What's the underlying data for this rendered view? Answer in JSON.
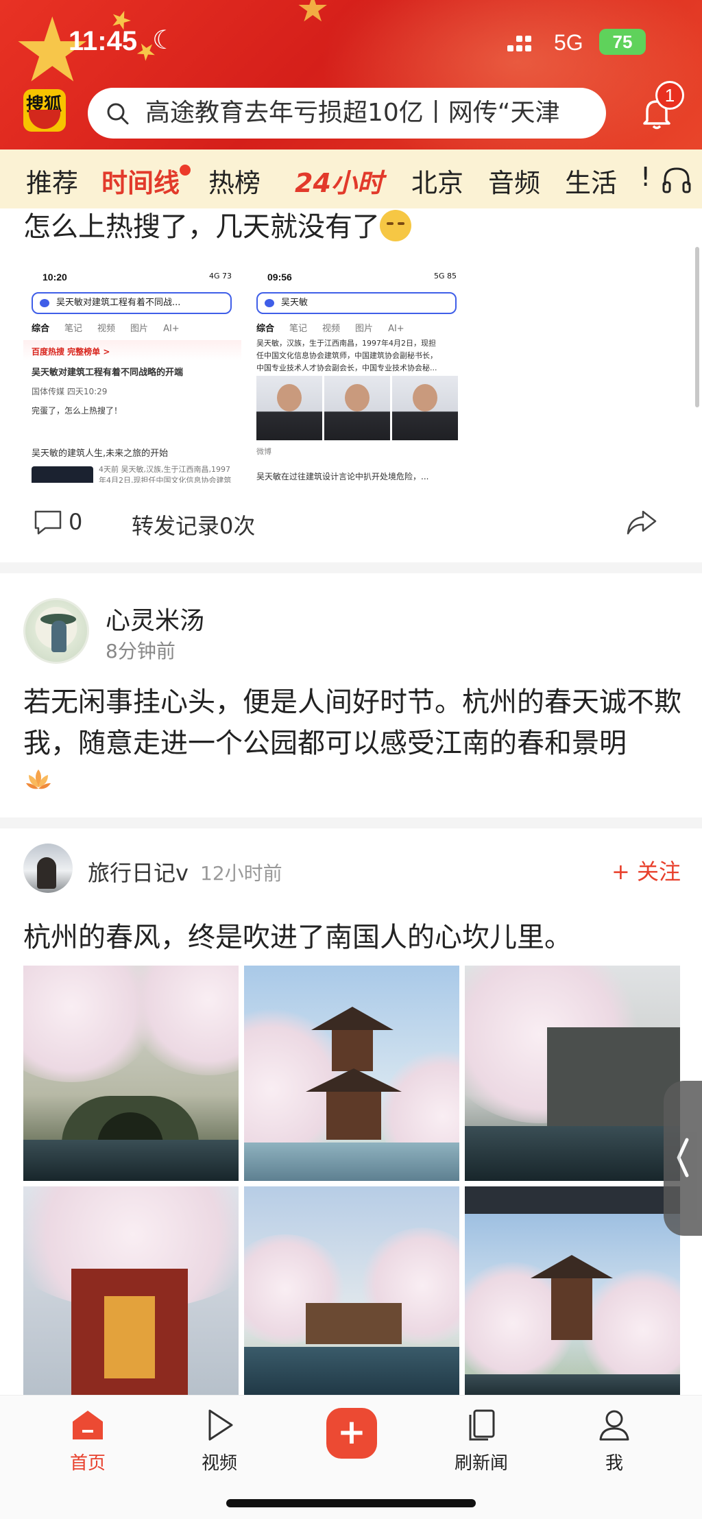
{
  "status_bar": {
    "time": "11:45",
    "network": "5G",
    "battery": "75"
  },
  "header": {
    "logo_text": "搜狐",
    "search_text": "高途教育去年亏损超10亿丨网传“天津",
    "notification_count": "1"
  },
  "channels": [
    {
      "label": "推荐"
    },
    {
      "label": "时间线",
      "active": true
    },
    {
      "label": "热榜"
    },
    {
      "label": "24小时"
    },
    {
      "label": "北京"
    },
    {
      "label": "音频"
    },
    {
      "label": "生活"
    },
    {
      "label": "!"
    }
  ],
  "post1": {
    "text": "怎么上热搜了，几天就没有了",
    "screens": [
      {
        "time": "10:20",
        "status": "4G 73",
        "search": "吴天敏对建筑工程有着不同战...",
        "tabs": [
          "综合",
          "笔记",
          "视频",
          "图片",
          "AI+"
        ],
        "lines": [
          "百度热搜 完整榜单 >",
          "吴天敏对建筑工程有着不同战略的开端",
          "国体传媒 四天10:29",
          "完蛋了，怎么上热搜了！",
          "吴天敏的建筑人生,未来之旅的开始",
          "4天前 吴天敏,汉族,生于江西南昌,1997年4月2日,现担任中国文化信息协会建筑"
        ]
      },
      {
        "time": "09:56",
        "status": "5G 85",
        "search": "吴天敏",
        "tabs": [
          "综合",
          "笔记",
          "视频",
          "图片",
          "AI+"
        ],
        "lines": [
          "吴天敏，汉族，生于江西南昌，1997年4月2日，现担",
          "任中国文化信息协会建筑师，中国建筑协会副秘书长，",
          "中国专业技术人才协会副会长，中国专业技术协会秘...",
          "微博",
          "吴天敏在过往建筑设计言论中扒开处境危险，..."
        ]
      }
    ],
    "comments": "0",
    "forward": "转发记录0次"
  },
  "post2": {
    "author": "心灵米汤",
    "time": "8分钟前",
    "text": "若无闲事挂心头，便是人间好时节。杭州的春天诚不欺我，随意走进一个公园都可以感受江南的春和景明"
  },
  "post3": {
    "author": "旅行日记v",
    "time": "12小时前",
    "follow": "+ 关注",
    "text": "杭州的春风，终是吹进了南国人的心坎儿里。"
  },
  "bottom_nav": [
    {
      "label": "首页",
      "icon": "home-icon",
      "active": true
    },
    {
      "label": "视频",
      "icon": "play-icon"
    },
    {
      "label": "+",
      "icon": "plus-icon"
    },
    {
      "label": "刷新闻",
      "icon": "pages-icon"
    },
    {
      "label": "我",
      "icon": "person-icon"
    }
  ],
  "colors": {
    "accent": "#e8402c",
    "header": "#d51f1a",
    "tabs_bg": "#fbf2d4"
  }
}
